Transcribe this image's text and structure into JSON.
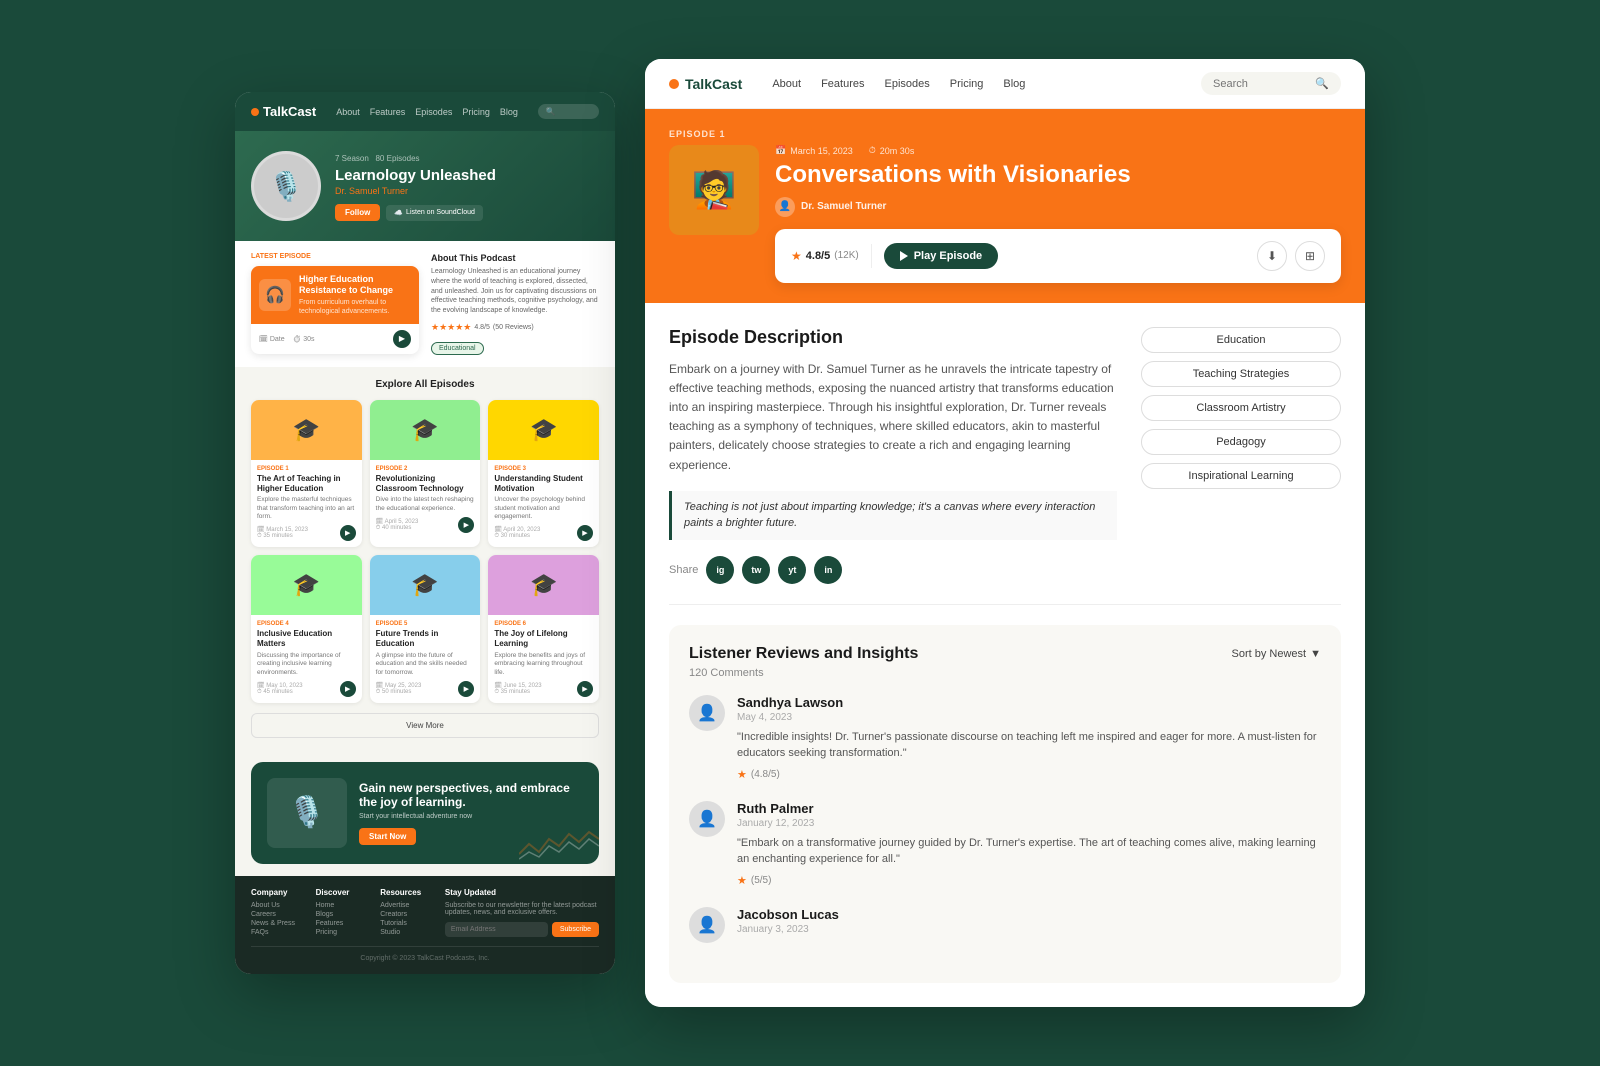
{
  "left": {
    "nav": {
      "logo": "TalkCast",
      "links": [
        "About",
        "Features",
        "Episodes",
        "Pricing",
        "Blog"
      ],
      "search_placeholder": "Search"
    },
    "hero": {
      "sessions": "7 Season",
      "episodes": "80 Episodes",
      "title": "Learnology Unleashed",
      "host": "Dr. Samuel Turner",
      "follow_label": "Follow",
      "soundcloud_label": "Listen on SoundCloud"
    },
    "latest_episode": {
      "label": "LATEST EPISODE",
      "title": "Higher Education Resistance to Change",
      "description": "From curriculum overhaul to technological advancements.",
      "tag": "Educational"
    },
    "about": {
      "title": "About This Podcast",
      "text": "Learnology Unleashed is an educational journey where the world of teaching is explored, dissected, and unleashed. Join us for captivating discussions on effective teaching methods, cognitive psychology, and the evolving landscape of knowledge.",
      "rating": "4.8/5",
      "reviews": "(50 Reviews)"
    },
    "explore": {
      "title": "Explore All Episodes",
      "episodes": [
        {
          "num": "EPISODE 1",
          "title": "The Art of Teaching in Higher Education",
          "desc": "Explore the masterful techniques that transform teaching into an art form.",
          "date": "March 15, 2023",
          "duration": "35 minutes",
          "color": "#FFB347"
        },
        {
          "num": "EPISODE 2",
          "title": "Revolutionizing Classroom Technology",
          "desc": "Dive into the latest tech reshaping the educational experience.",
          "date": "April 5, 2023",
          "duration": "40 minutes",
          "color": "#90EE90"
        },
        {
          "num": "EPISODE 3",
          "title": "Understanding Student Motivation",
          "desc": "Uncover the psychology behind student motivation and engagement.",
          "date": "April 20, 2023",
          "duration": "30 minutes",
          "color": "#FFD700"
        },
        {
          "num": "EPISODE 4",
          "title": "Inclusive Education Matters",
          "desc": "Discussing the importance of creating inclusive learning environments.",
          "date": "May 10, 2023",
          "duration": "45 minutes",
          "color": "#98FB98"
        },
        {
          "num": "EPISODE 5",
          "title": "Future Trends in Education",
          "desc": "A glimpse into the future of education and the skills needed for tomorrow.",
          "date": "May 25, 2023",
          "duration": "50 minutes",
          "color": "#87CEEB"
        },
        {
          "num": "EPISODE 6",
          "title": "The Joy of Lifelong Learning",
          "desc": "Explore the benefits and joys of embracing learning throughout life.",
          "date": "June 15, 2023",
          "duration": "35 minutes",
          "color": "#DDA0DD"
        }
      ],
      "view_more": "View More"
    },
    "cta": {
      "title": "Gain new perspectives, and embrace the joy of learning.",
      "subtitle": "Start your intellectual adventure now",
      "btn_label": "Start Now"
    },
    "footer": {
      "cols": [
        {
          "title": "Company",
          "links": [
            "About Us",
            "Careers",
            "News & Press",
            "FAQs"
          ]
        },
        {
          "title": "Discover",
          "links": [
            "Home",
            "Blogs",
            "Features",
            "Pricing"
          ]
        },
        {
          "title": "Resources",
          "links": [
            "Advertise",
            "Creators",
            "Tutorials",
            "Studio"
          ]
        },
        {
          "title": "Stay Updated",
          "desc": "Subscribe to our newsletter for the latest podcast updates, news, and exclusive offers.",
          "placeholder": "Email Address",
          "btn": "Subscribe"
        }
      ],
      "copyright": "Copyright © 2023 TalkCast Podcasts, Inc."
    }
  },
  "right": {
    "nav": {
      "logo": "TalkCast",
      "links": [
        "About",
        "Features",
        "Episodes",
        "Pricing",
        "Blog"
      ],
      "search_placeholder": "Search"
    },
    "episode": {
      "badge": "EPISODE 1",
      "title": "Conversations with Visionaries",
      "host": "Dr. Samuel Turner",
      "date": "March 15, 2023",
      "duration": "20m 30s",
      "rating": "4.8/5",
      "rating_count": "(12K)",
      "play_label": "Play Episode"
    },
    "description": {
      "title": "Episode Description",
      "text": "Embark on a journey with Dr. Samuel Turner as he unravels the intricate tapestry of effective teaching methods, exposing the nuanced artistry that transforms education into an inspiring masterpiece. Through his insightful exploration, Dr. Turner reveals teaching as a symphony of techniques, where skilled educators, akin to masterful painters, delicately choose strategies to create a rich and engaging learning experience.",
      "quote": "Teaching is not just about imparting knowledge; it's a canvas where every interaction paints a brighter future.",
      "share_label": "Share",
      "social": [
        "ig",
        "tw",
        "yt",
        "in"
      ]
    },
    "tags": [
      "Education",
      "Teaching Strategies",
      "Classroom Artistry",
      "Pedagogy",
      "Inspirational Learning"
    ],
    "reviews": {
      "title": "Listener Reviews and Insights",
      "count": "120 Comments",
      "sort_label": "Sort by Newest",
      "items": [
        {
          "name": "Sandhya Lawson",
          "date": "May 4, 2023",
          "text": "\"Incredible insights! Dr. Turner's passionate discourse on teaching left me inspired and eager for more. A must-listen for educators seeking transformation.\"",
          "rating": "(4.8/5)"
        },
        {
          "name": "Ruth Palmer",
          "date": "January 12, 2023",
          "text": "\"Embark on a transformative journey guided by Dr. Turner's expertise. The art of teaching comes alive, making learning an enchanting experience for all.\"",
          "rating": "(5/5)"
        },
        {
          "name": "Jacobson Lucas",
          "date": "January 3, 2023",
          "text": "",
          "rating": ""
        }
      ]
    }
  }
}
